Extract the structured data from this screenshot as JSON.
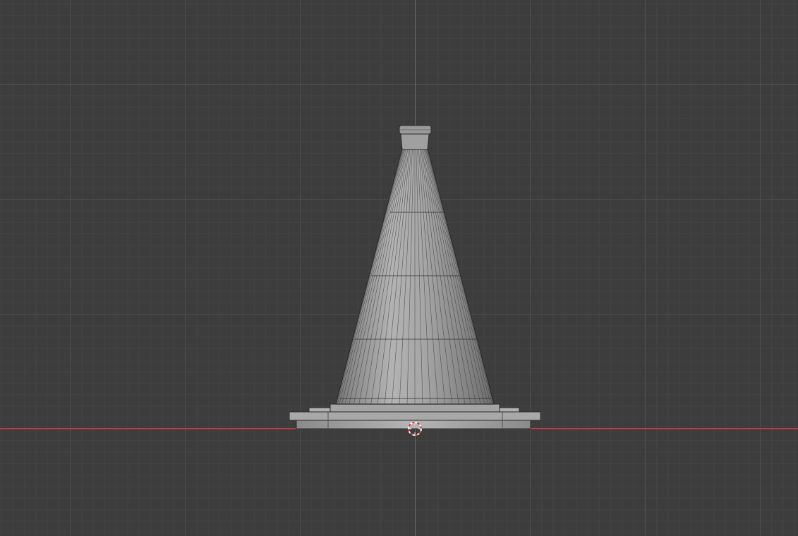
{
  "viewport": {
    "type": "3d-viewport",
    "view": "front-orthographic",
    "object": "traffic-cone",
    "shading": "solid-wireframe",
    "grid_visible": true
  },
  "colors": {
    "background": "#3d3d3d",
    "grid_line": "#505050",
    "x_axis": "#a84a54",
    "z_axis": "#4a6ea8",
    "mesh_fill": "#9d9d9d",
    "mesh_edge": "#2a2a2a"
  },
  "icons": {
    "cursor": "3d-cursor-icon"
  }
}
